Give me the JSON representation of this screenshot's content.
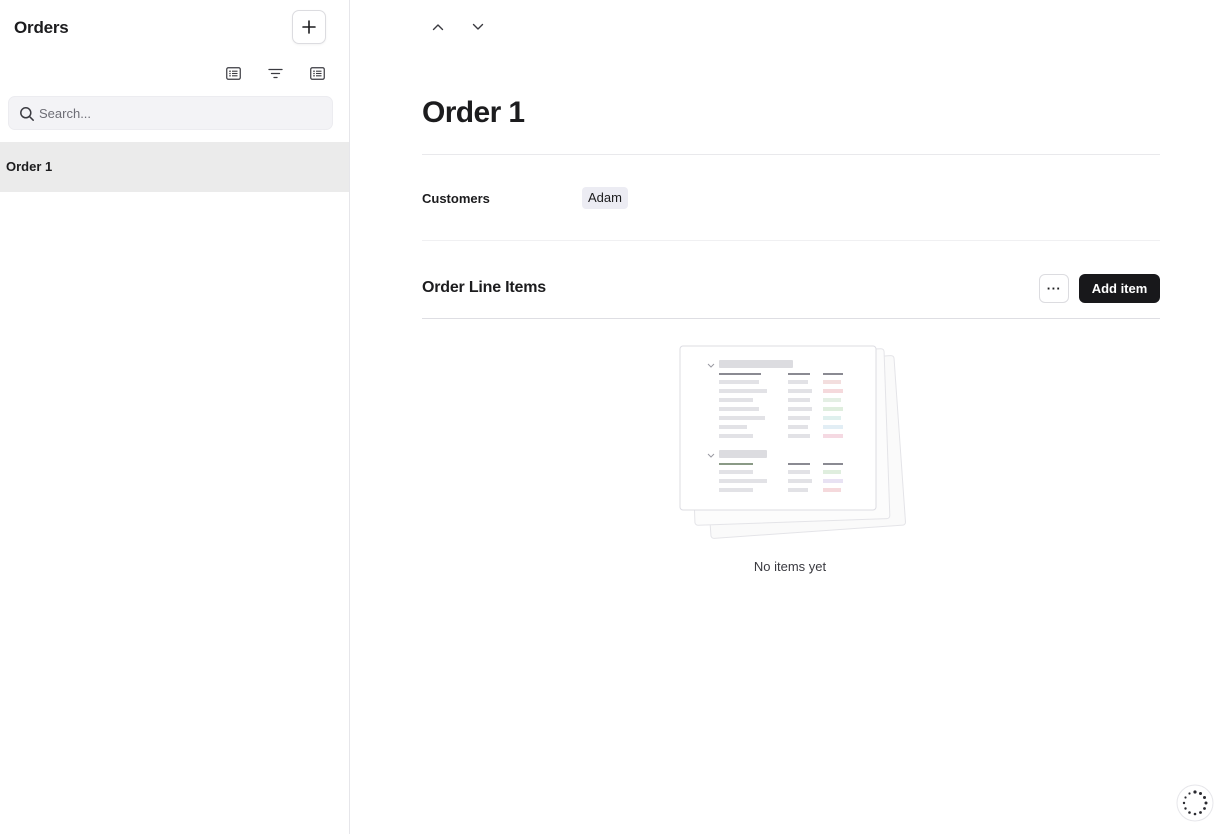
{
  "sidebar": {
    "title": "Orders",
    "add_button_icon": "plus-icon",
    "toolbar_icons": [
      "list-view-icon",
      "filter-icon",
      "list-view-icon"
    ],
    "search": {
      "placeholder": "Search...",
      "value": ""
    },
    "items": [
      {
        "label": "Order 1",
        "selected": true
      }
    ]
  },
  "main": {
    "nav_icons": [
      "chevron-up-icon",
      "chevron-down-icon"
    ],
    "title": "Order 1",
    "fields": [
      {
        "label": "Customers",
        "value": "Adam"
      }
    ],
    "line_items": {
      "title": "Order Line Items",
      "more_label": "···",
      "add_label": "Add item",
      "empty_text": "No items yet"
    }
  },
  "colors": {
    "accent_button": "#18181b",
    "selected_row": "#ebebeb",
    "chip_bg": "#ececf3"
  }
}
